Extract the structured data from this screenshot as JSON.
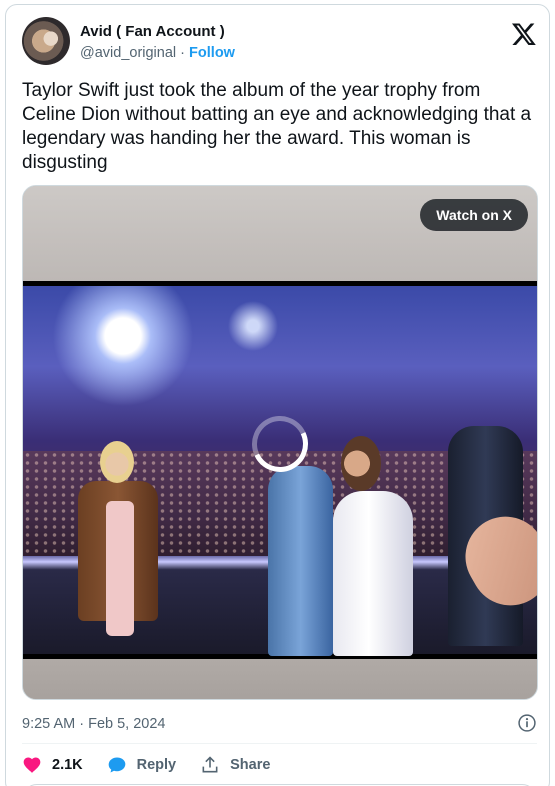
{
  "post": {
    "display_name": "Avid ( Fan Account )",
    "handle": "@avid_original",
    "separator": "·",
    "follow_label": "Follow",
    "text": "Taylor Swift just took the album of the year trophy from Celine Dion without batting an eye and acknowledging that a legendary was handing her the award. This woman is disgusting",
    "timestamp": "9:25 AM · Feb 5, 2024"
  },
  "media": {
    "watch_label": "Watch on X"
  },
  "actions": {
    "like_count": "2.1K",
    "reply_label": "Reply",
    "share_label": "Share"
  },
  "colors": {
    "accent": "#1d9bf0",
    "like": "#f91880",
    "text_secondary": "#536471"
  },
  "icons": {
    "brand": "x-logo-icon",
    "info": "info-icon",
    "like": "heart-icon",
    "reply": "reply-bubble-icon",
    "share": "share-icon",
    "loading": "loading-spinner-icon"
  }
}
